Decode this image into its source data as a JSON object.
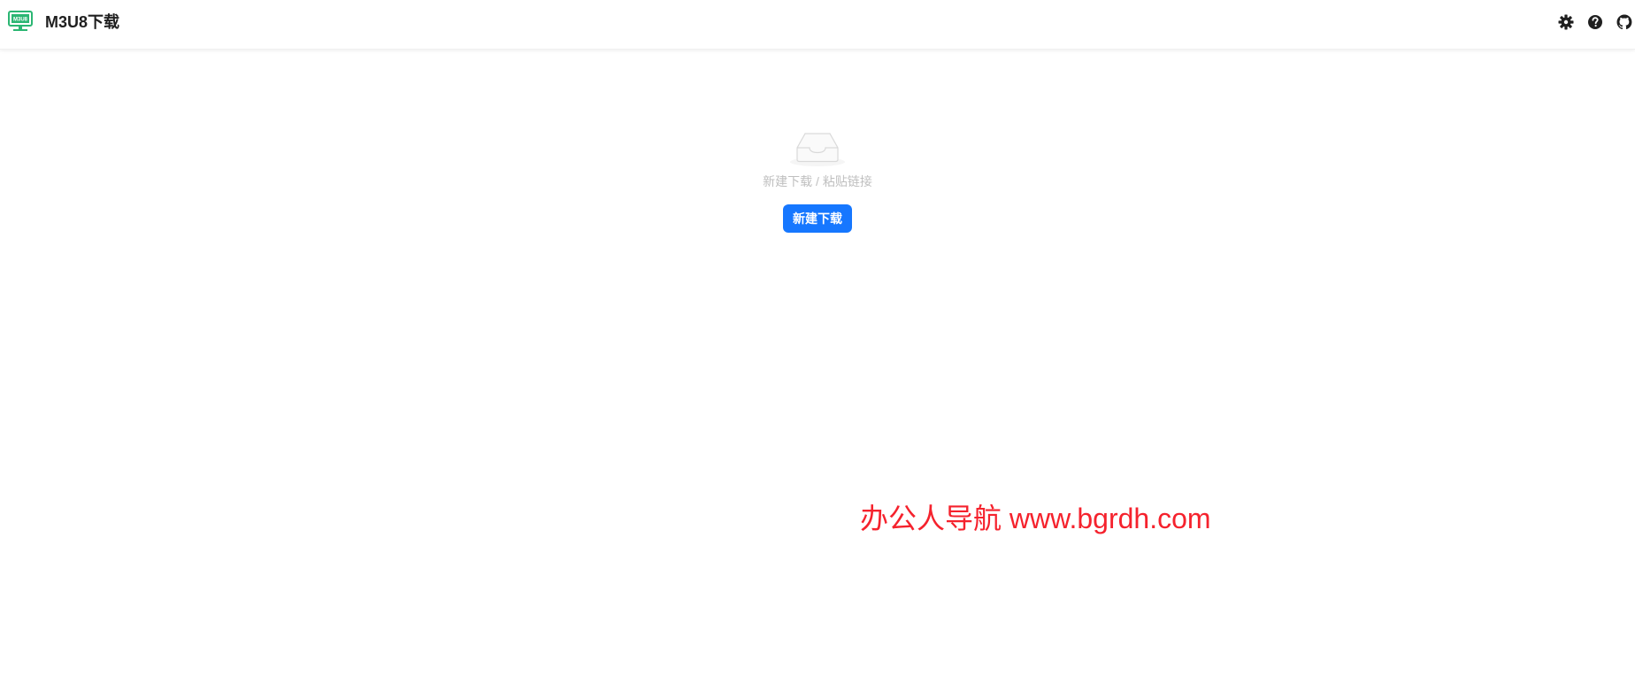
{
  "header": {
    "app_title": "M3U8下载",
    "logo_text": "M3U8",
    "icons": [
      "gear-icon",
      "question-circle-icon",
      "github-icon"
    ]
  },
  "empty_state": {
    "description": "新建下载 / 粘贴链接",
    "button_label": "新建下载"
  },
  "watermark": "办公人导航 www.bgrdh.com",
  "colors": {
    "primary": "#1677ff",
    "logo_green": "#2bb673",
    "watermark": "#f5222d",
    "muted_text": "#bfbfbf"
  }
}
